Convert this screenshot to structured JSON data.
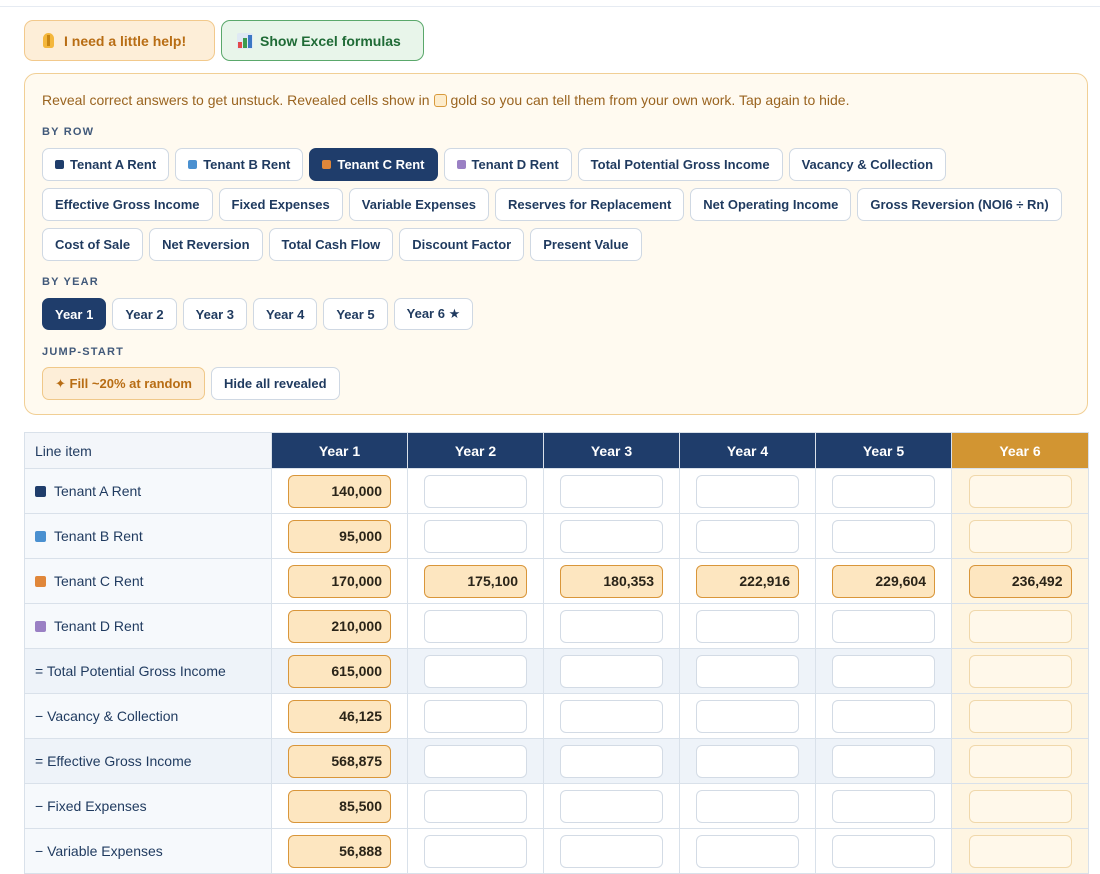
{
  "top_buttons": {
    "help_label": "I need a little help!",
    "excel_label": "Show Excel formulas"
  },
  "panel": {
    "note_before": "Reveal correct answers to get unstuck. Revealed cells show in",
    "note_after": "gold so you can tell them from your own work. Tap again to hide.",
    "by_row_label": "BY ROW",
    "by_year_label": "BY YEAR",
    "jump_label": "JUMP-START",
    "row_chips": [
      {
        "label": "Tenant A Rent",
        "dot": "#1f3d6b",
        "active": false
      },
      {
        "label": "Tenant B Rent",
        "dot": "#4a90d0",
        "active": false
      },
      {
        "label": "Tenant C Rent",
        "dot": "#e0873a",
        "active": true
      },
      {
        "label": "Tenant D Rent",
        "dot": "#9a80c4",
        "active": false
      },
      {
        "label": "Total Potential Gross Income"
      },
      {
        "label": "Vacancy & Collection"
      },
      {
        "label": "Effective Gross Income"
      },
      {
        "label": "Fixed Expenses"
      },
      {
        "label": "Variable Expenses"
      },
      {
        "label": "Reserves for Replacement"
      },
      {
        "label": "Net Operating Income"
      },
      {
        "label": "Gross Reversion (NOI6 ÷ Rn)"
      },
      {
        "label": "Cost of Sale"
      },
      {
        "label": "Net Reversion"
      },
      {
        "label": "Total Cash Flow"
      },
      {
        "label": "Discount Factor"
      },
      {
        "label": "Present Value"
      }
    ],
    "year_chips": [
      {
        "label": "Year 1",
        "active": true
      },
      {
        "label": "Year 2"
      },
      {
        "label": "Year 3"
      },
      {
        "label": "Year 4"
      },
      {
        "label": "Year 5"
      },
      {
        "label": "Year 6 ★"
      }
    ],
    "fill_random_label": "✦ Fill ~20% at random",
    "hide_all_label": "Hide all revealed"
  },
  "table": {
    "line_item_header": "Line item",
    "year_headers": [
      "Year 1",
      "Year 2",
      "Year 3",
      "Year 4",
      "Year 5",
      "Year 6"
    ],
    "rows": [
      {
        "label": "Tenant A Rent",
        "dot": "#1f3d6b",
        "total": false,
        "values": [
          "140,000",
          "",
          "",
          "",
          "",
          ""
        ]
      },
      {
        "label": "Tenant B Rent",
        "dot": "#4a90d0",
        "total": false,
        "values": [
          "95,000",
          "",
          "",
          "",
          "",
          ""
        ]
      },
      {
        "label": "Tenant C Rent",
        "dot": "#e0873a",
        "total": false,
        "values": [
          "170,000",
          "175,100",
          "180,353",
          "222,916",
          "229,604",
          "236,492"
        ]
      },
      {
        "label": "Tenant D Rent",
        "dot": "#9a80c4",
        "total": false,
        "values": [
          "210,000",
          "",
          "",
          "",
          "",
          ""
        ]
      },
      {
        "label": "= Total Potential Gross Income",
        "dot": null,
        "total": true,
        "values": [
          "615,000",
          "",
          "",
          "",
          "",
          ""
        ]
      },
      {
        "label": "− Vacancy & Collection",
        "dot": null,
        "total": false,
        "values": [
          "46,125",
          "",
          "",
          "",
          "",
          ""
        ]
      },
      {
        "label": "= Effective Gross Income",
        "dot": null,
        "total": true,
        "values": [
          "568,875",
          "",
          "",
          "",
          "",
          ""
        ]
      },
      {
        "label": "− Fixed Expenses",
        "dot": null,
        "total": false,
        "values": [
          "85,500",
          "",
          "",
          "",
          "",
          ""
        ]
      },
      {
        "label": "− Variable Expenses",
        "dot": null,
        "total": false,
        "values": [
          "56,888",
          "",
          "",
          "",
          "",
          ""
        ]
      }
    ]
  },
  "colors": {
    "navy": "#1f3d6b",
    "gold_header": "#d29532",
    "revealed_fill": "#fde6c0",
    "revealed_border": "#d9963a"
  }
}
